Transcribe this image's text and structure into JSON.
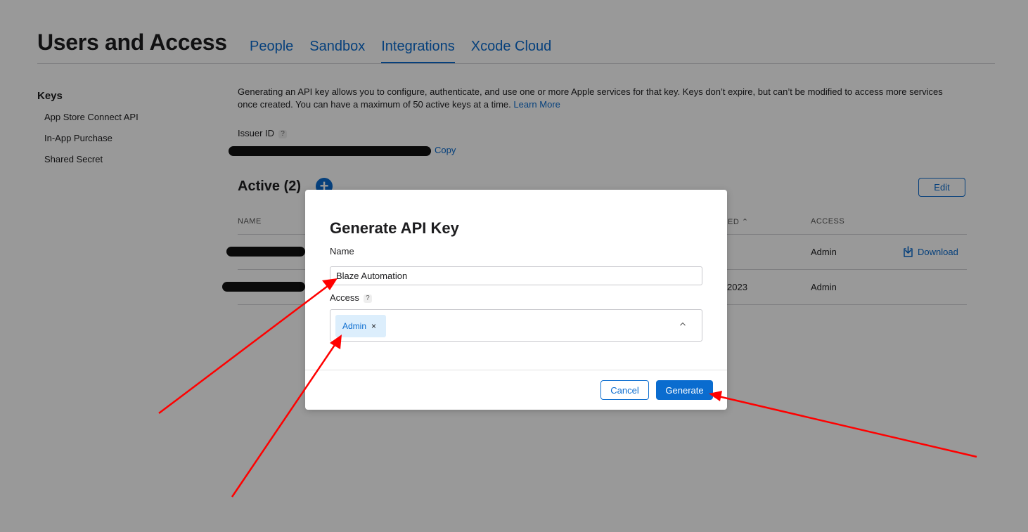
{
  "header": {
    "title": "Users and Access",
    "tabs": [
      {
        "label": "People",
        "active": false
      },
      {
        "label": "Sandbox",
        "active": false
      },
      {
        "label": "Integrations",
        "active": true
      },
      {
        "label": "Xcode Cloud",
        "active": false
      }
    ]
  },
  "sidebar": {
    "title": "Keys",
    "items": [
      {
        "label": "App Store Connect API"
      },
      {
        "label": "In-App Purchase"
      },
      {
        "label": "Shared Secret"
      }
    ]
  },
  "main": {
    "description": "Generating an API key allows you to configure, authenticate, and use one or more Apple services for that key. Keys don’t expire, but can’t be modified to access more services once created. You can have a maximum of 50 active keys at a time.",
    "learn_more": "Learn More",
    "issuer_label": "Issuer ID",
    "help_glyph": "?",
    "copy_label": "Copy",
    "active_title": "Active (2)",
    "edit_label": "Edit",
    "columns": {
      "name": "NAME",
      "created_partial": "ED",
      "access": "ACCESS"
    },
    "rows": [
      {
        "date_partial": "",
        "access": "Admin",
        "action": "Download"
      },
      {
        "date_partial": "2023",
        "access": "Admin",
        "action": ""
      }
    ]
  },
  "modal": {
    "title": "Generate API Key",
    "name_label": "Name",
    "name_value": "Blaze Automation",
    "access_label": "Access",
    "access_chip": "Admin",
    "chip_remove": "×",
    "cancel_label": "Cancel",
    "generate_label": "Generate"
  },
  "colors": {
    "accent": "#0a6ccf",
    "annotation_arrow": "#ff0000"
  }
}
